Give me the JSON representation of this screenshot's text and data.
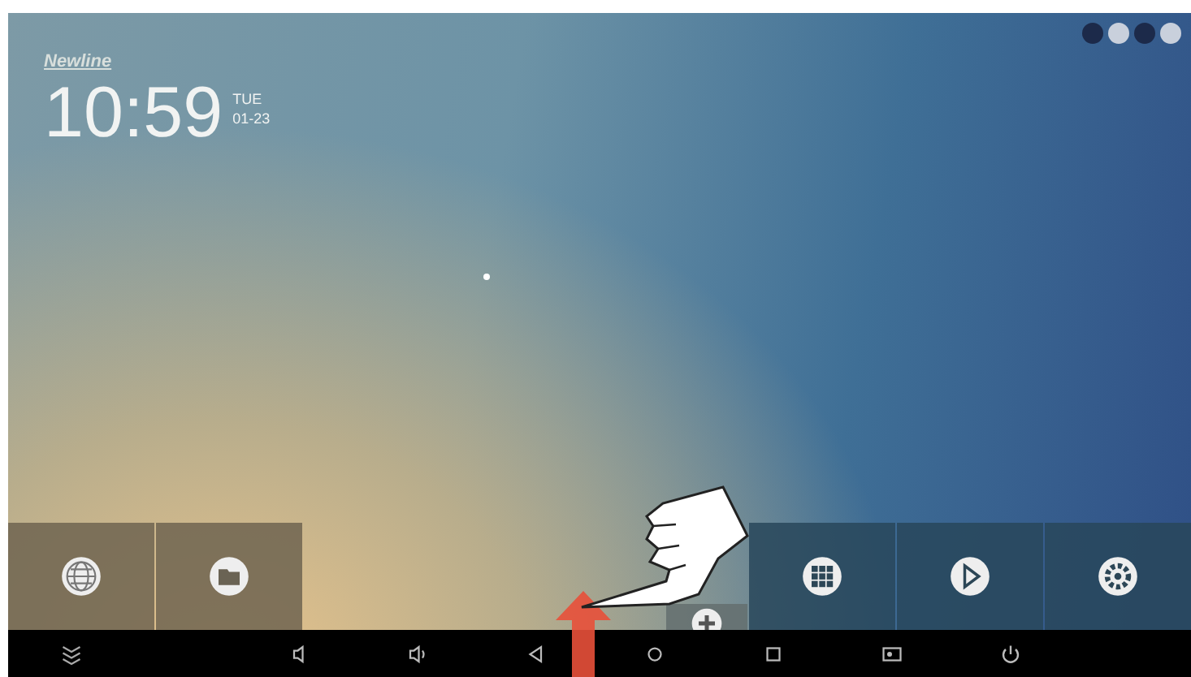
{
  "logo": {
    "text": "Newline"
  },
  "clock": {
    "time": "10:59",
    "day": "TUE",
    "date": "01-23"
  },
  "status_icons": [
    {
      "kind": "circle-dark"
    },
    {
      "kind": "circle-light"
    },
    {
      "kind": "circle-dark"
    },
    {
      "kind": "circle-light"
    }
  ],
  "tiles_left": [
    {
      "kind": "browser"
    },
    {
      "kind": "folder"
    }
  ],
  "tiles_right": [
    {
      "kind": "add"
    },
    {
      "kind": "apps"
    },
    {
      "kind": "play"
    },
    {
      "kind": "settings"
    }
  ],
  "nav_bar": [
    {
      "kind": "collapse"
    },
    {
      "kind": "volume-down"
    },
    {
      "kind": "volume-up"
    },
    {
      "kind": "back"
    },
    {
      "kind": "home"
    },
    {
      "kind": "recents"
    },
    {
      "kind": "screenshot"
    },
    {
      "kind": "power"
    }
  ]
}
